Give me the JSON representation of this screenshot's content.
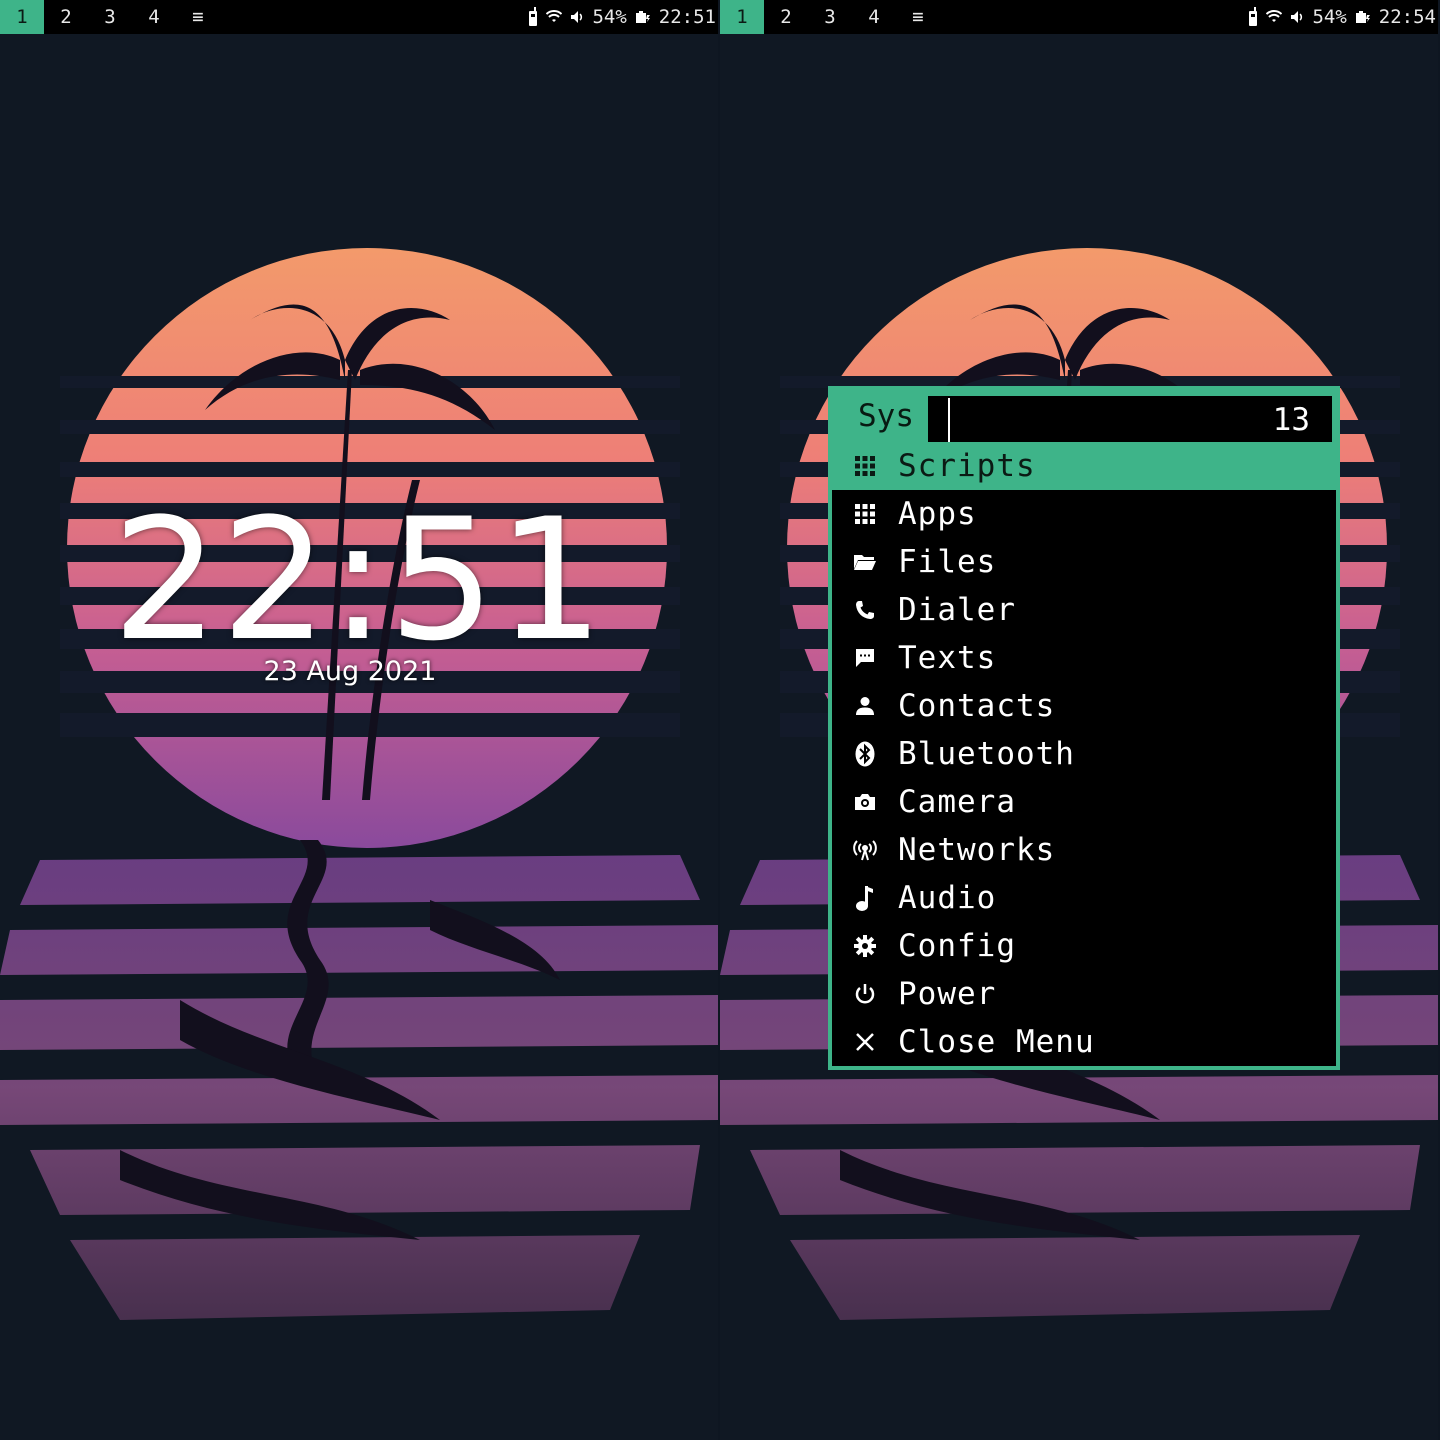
{
  "left": {
    "topbar": {
      "workspaces": [
        "1",
        "2",
        "3",
        "4"
      ],
      "active_workspace": "1",
      "menu_glyph": "≡",
      "battery": "54%",
      "time": "22:51"
    },
    "lockscreen": {
      "time": "22:51",
      "date": "23 Aug 2021"
    }
  },
  "right": {
    "topbar": {
      "workspaces": [
        "1",
        "2",
        "3",
        "4"
      ],
      "active_workspace": "1",
      "menu_glyph": "≡",
      "battery": "54%",
      "time": "22:54"
    },
    "menu": {
      "prompt": "Sys",
      "input_value": "",
      "count": "13",
      "items": [
        {
          "label": "Scripts",
          "icon": "grid-icon",
          "selected": true
        },
        {
          "label": "Apps",
          "icon": "grid-icon"
        },
        {
          "label": "Files",
          "icon": "folder-icon"
        },
        {
          "label": "Dialer",
          "icon": "phone-icon"
        },
        {
          "label": "Texts",
          "icon": "message-icon"
        },
        {
          "label": "Contacts",
          "icon": "person-icon"
        },
        {
          "label": "Bluetooth",
          "icon": "bluetooth-icon"
        },
        {
          "label": "Camera",
          "icon": "camera-icon"
        },
        {
          "label": "Networks",
          "icon": "antenna-icon"
        },
        {
          "label": "Audio",
          "icon": "music-note-icon"
        },
        {
          "label": "Config",
          "icon": "gear-icon"
        },
        {
          "label": "Power",
          "icon": "power-icon"
        },
        {
          "label": "Close Menu",
          "icon": "close-icon"
        }
      ]
    }
  },
  "colors": {
    "accent": "#3eb489",
    "bar_bg": "#000000",
    "sun_top": "#f2906a",
    "sun_bottom": "#9a4f9c",
    "night": "#101823"
  }
}
